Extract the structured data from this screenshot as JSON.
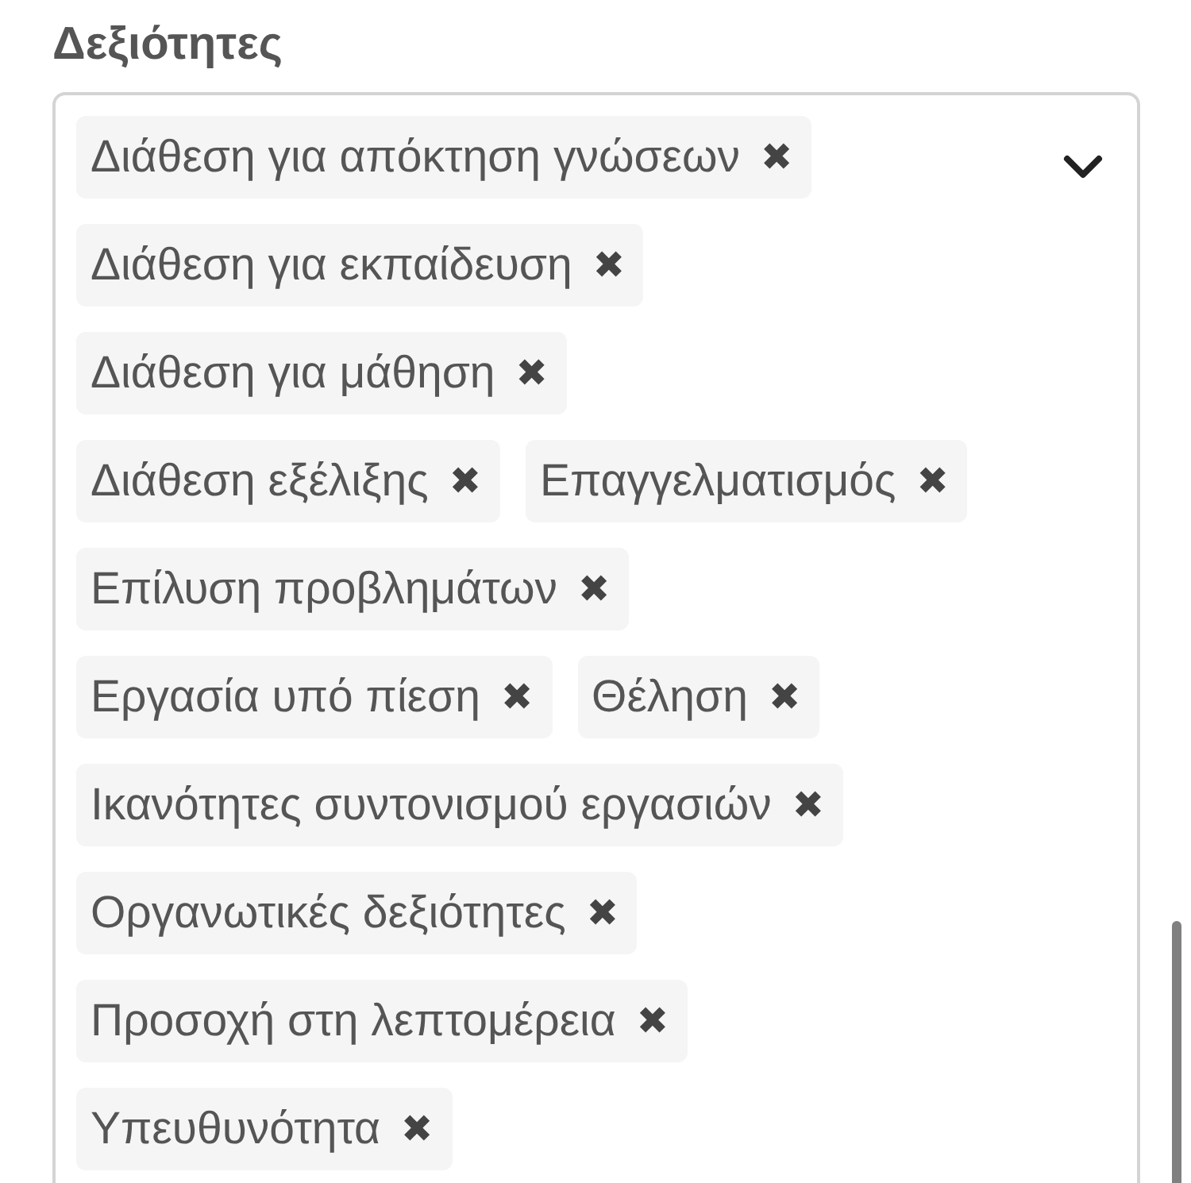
{
  "section": {
    "title": "Δεξιότητες"
  },
  "select": {
    "chips": [
      {
        "label": "Διάθεση για απόκτηση γνώσεων",
        "remove": "✖"
      },
      {
        "label": "Διάθεση για εκπαίδευση",
        "remove": "✖"
      },
      {
        "label": "Διάθεση για μάθηση",
        "remove": "✖"
      },
      {
        "label": "Διάθεση εξέλιξης",
        "remove": "✖"
      },
      {
        "label": "Επαγγελματισμός",
        "remove": "✖"
      },
      {
        "label": "Επίλυση προβλημάτων",
        "remove": "✖"
      },
      {
        "label": "Εργασία υπό πίεση",
        "remove": "✖"
      },
      {
        "label": "Θέληση",
        "remove": "✖"
      },
      {
        "label": "Ικανότητες συντονισμού εργασιών",
        "remove": "✖"
      },
      {
        "label": "Οργανωτικές δεξιότητες",
        "remove": "✖"
      },
      {
        "label": "Προσοχή στη λεπτομέρεια",
        "remove": "✖"
      },
      {
        "label": "Υπευθυνότητα",
        "remove": "✖"
      }
    ]
  }
}
